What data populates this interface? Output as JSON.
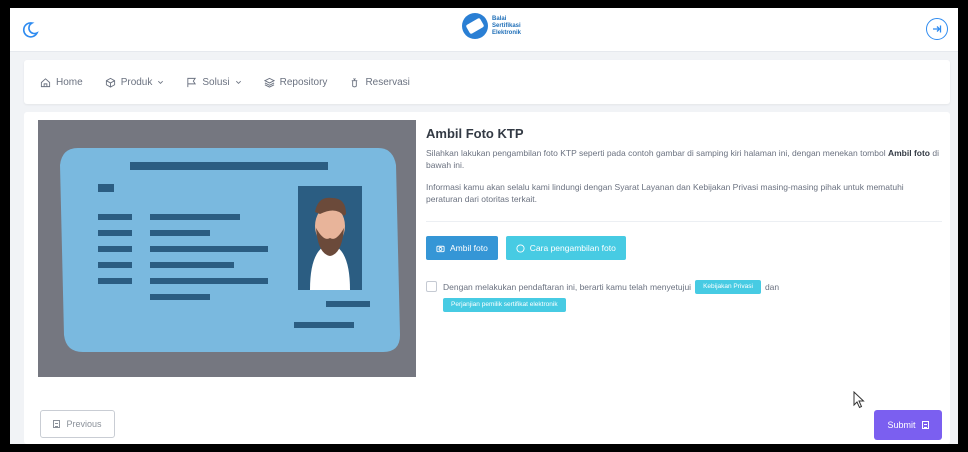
{
  "header": {
    "logo_line1": "Balai",
    "logo_line2": "Sertifikasi",
    "logo_line3": "Elektronik",
    "brand_color": "#2a7fd4"
  },
  "nav": {
    "items": [
      {
        "label": "Home",
        "icon": "home-icon"
      },
      {
        "label": "Produk",
        "icon": "box-icon",
        "dropdown": true
      },
      {
        "label": "Solusi",
        "icon": "flag-icon",
        "dropdown": true
      },
      {
        "label": "Repository",
        "icon": "layers-icon"
      },
      {
        "label": "Reservasi",
        "icon": "touch-icon"
      }
    ]
  },
  "content": {
    "title": "Ambil Foto KTP",
    "para1_pre": "Silahkan lakukan pengambilan foto KTP seperti pada contoh gambar di samping kiri halaman ini, dengan menekan tombol ",
    "para1_bold": "Ambil foto",
    "para1_post": " di bawah ini.",
    "para2": "Informasi kamu akan selalu kami lindungi dengan Syarat Layanan dan Kebijakan Privasi masing-masing pihak untuk mematuhi peraturan dari otoritas terkait.",
    "btn_take_photo": "Ambil foto",
    "btn_how_to": "Cara pengambilan foto",
    "agree_text": "Dengan melakukan pendaftaran ini, berarti kamu telah menyetujui",
    "agree_privacy": "Kebijakan Privasi",
    "agree_and": "dan",
    "agree_agreement": "Perjanjian pemilik sertifikat elektronik"
  },
  "footer": {
    "previous": "Previous",
    "submit": "Submit"
  },
  "colors": {
    "primary": "#3596d6",
    "cyan": "#47cbe3",
    "submit": "#7b5ff0"
  }
}
